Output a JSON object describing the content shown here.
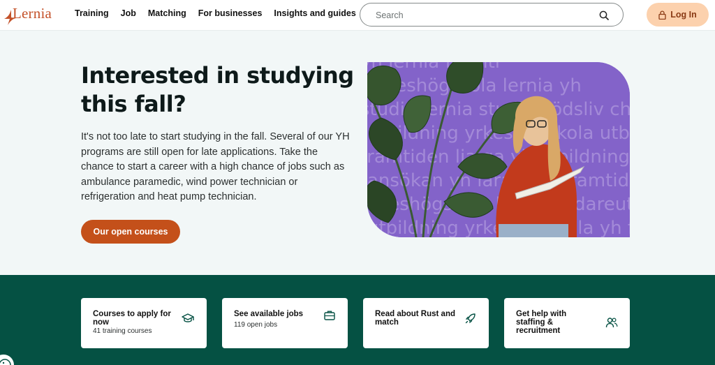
{
  "brand": {
    "name": "Lernia",
    "accent": "#c4522a"
  },
  "nav": {
    "items": [
      {
        "label": "Training"
      },
      {
        "label": "Job"
      },
      {
        "label": "Matching"
      },
      {
        "label": "For businesses"
      },
      {
        "label": "Insights and guides"
      }
    ]
  },
  "search": {
    "placeholder": "Search",
    "icon": "search-icon"
  },
  "login": {
    "label": "Log In",
    "icon": "lock-icon"
  },
  "hero": {
    "title": "Interested in studying this fall?",
    "body": "It's not too late to start studying in the fall. Several of our YH programs are still open for late applications. Take the chance to start a career with a high chance of jobs such as ambulance paramedic, wind power technician or refrigeration and heat pump technician.",
    "cta_label": "Our open courses",
    "image_words": [
      "yh lernia framti",
      "yrkeshögskola lernia yh",
      "studie lernia studiestödsliv chans",
      "utbildning yrkeshögskola utbildning lia",
      "framtiden lia ga yh utbildning",
      "ansökan yh lärare lia framtid",
      "yrkeshögskola kurser vidareutbildning",
      "utbildning yrkeshögskola yh framtid"
    ]
  },
  "cards": [
    {
      "title": "Courses to apply for now",
      "subtitle": "41 training courses",
      "icon": "graduation-cap-icon"
    },
    {
      "title": "See available jobs",
      "subtitle": "119 open jobs",
      "icon": "briefcase-icon"
    },
    {
      "title": "Read about Rust and match",
      "subtitle": "",
      "icon": "rocket-icon"
    },
    {
      "title": "Get help with staffing & recruitment",
      "subtitle": "",
      "icon": "people-icon"
    }
  ],
  "colors": {
    "band": "#055143",
    "cta": "#c4501a",
    "login_bg": "#fcd1ad",
    "hero_bg": "#8363c9"
  }
}
